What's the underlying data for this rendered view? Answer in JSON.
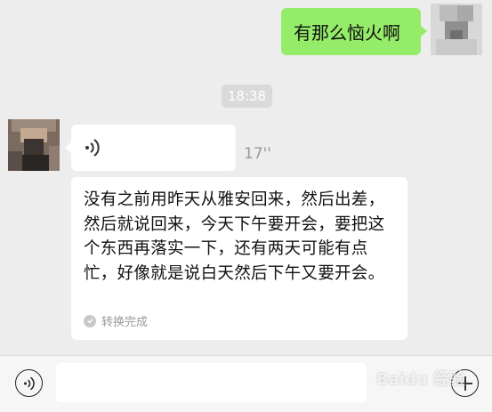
{
  "chat": {
    "outgoing_message": "有那么恼火啊",
    "timestamp": "18:38",
    "voice_message": {
      "duration": "17''",
      "transcript": "没有之前用昨天从雅安回来，然后出差，然后就说回来，今天下午要开会，要把这个东西再落实一下，还有两天可能有点忙，好像就是说白天然后下午又要开会。",
      "status": "转换完成"
    }
  },
  "input_bar": {
    "voice_icon": "voice-icon",
    "add_icon": "plus-icon",
    "placeholder": ""
  },
  "watermark": "Baidu 经验",
  "colors": {
    "outgoing_bubble": "#95ec69",
    "background": "#ededed"
  }
}
